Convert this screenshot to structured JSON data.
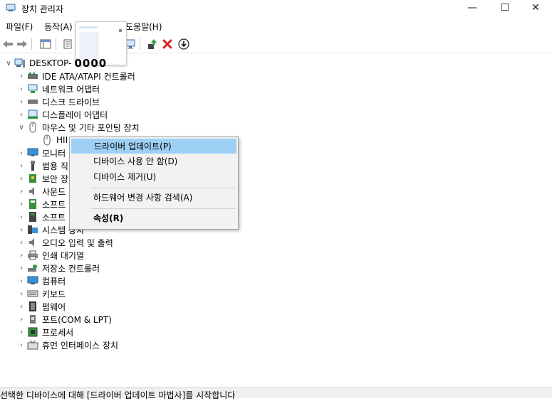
{
  "window": {
    "title": "장치 관리자",
    "controls": {
      "minimize": "—",
      "maximize": "☐",
      "close": "✕"
    }
  },
  "menu": {
    "file": "파일(F)",
    "action": "동작(A)",
    "help": "도움말(H)"
  },
  "tree": {
    "root": {
      "label": "DESKTOP-",
      "tail": "0000"
    },
    "items": [
      {
        "label": "IDE ATA/ATAPI 컨트롤러",
        "icon": "ide-controller-icon",
        "expanded": false
      },
      {
        "label": "네트워크 어댑터",
        "icon": "network-adapter-icon",
        "expanded": false
      },
      {
        "label": "디스크 드라이브",
        "icon": "disk-drive-icon",
        "expanded": false
      },
      {
        "label": "디스플레이 어댑터",
        "icon": "display-adapter-icon",
        "expanded": false
      },
      {
        "label": "마우스 및 기타 포인팅 장치",
        "icon": "mouse-icon",
        "expanded": true
      },
      {
        "label": "HII",
        "icon": "mouse-icon",
        "child": true
      },
      {
        "label": "모니터",
        "icon": "monitor-icon"
      },
      {
        "label": "범용 직",
        "icon": "usb-icon"
      },
      {
        "label": "보안 장",
        "icon": "security-device-icon"
      },
      {
        "label": "사운드",
        "icon": "sound-icon"
      },
      {
        "label": "소프트",
        "icon": "software-component-icon"
      },
      {
        "label": "소프트",
        "icon": "software-device-icon"
      },
      {
        "label": "시스템 장치",
        "icon": "system-device-icon"
      },
      {
        "label": "오디오 입력 및 출력",
        "icon": "audio-icon"
      },
      {
        "label": "인쇄 대기열",
        "icon": "printer-icon"
      },
      {
        "label": "저장소 컨트롤러",
        "icon": "storage-controller-icon"
      },
      {
        "label": "컴퓨터",
        "icon": "computer-icon"
      },
      {
        "label": "키보드",
        "icon": "keyboard-icon"
      },
      {
        "label": "펌웨어",
        "icon": "firmware-icon"
      },
      {
        "label": "포트(COM & LPT)",
        "icon": "port-icon"
      },
      {
        "label": "프로세서",
        "icon": "processor-icon"
      },
      {
        "label": "휴먼 인터페이스 장치",
        "icon": "hid-icon"
      }
    ]
  },
  "context_menu": {
    "update_driver": "드라이버 업데이트(P)",
    "disable_device": "디바이스 사용 안 함(D)",
    "uninstall_device": "디바이스 제거(U)",
    "scan_hardware": "하드웨어 변경 사항 검색(A)",
    "properties": "속성(R)"
  },
  "status": {
    "text": "선택한 디바이스에 대해 [드라이버 업데이트 마법사]를 시작합니다"
  },
  "colors": {
    "highlight": "#9ed0f5",
    "menu_bg": "#f2f2f2",
    "remove_red": "#d9231f",
    "update_green": "#2e9d3e"
  }
}
